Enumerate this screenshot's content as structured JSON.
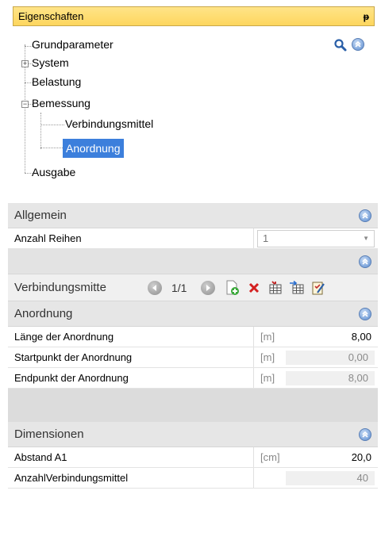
{
  "panel": {
    "title": "Eigenschaften",
    "pin_icon": "pin-icon"
  },
  "tree": {
    "items": [
      {
        "label": "Grundparameter"
      },
      {
        "label": "System"
      },
      {
        "label": "Belastung"
      },
      {
        "label": "Bemessung"
      },
      {
        "label": "Verbindungsmittel"
      },
      {
        "label": "Anordnung"
      },
      {
        "label": "Ausgabe"
      }
    ],
    "expanders": {
      "system": "+",
      "bemessung": "−"
    }
  },
  "grid": {
    "allgemein": {
      "title": "Allgemein",
      "anzahl_reihen_label": "Anzahl Reihen",
      "anzahl_reihen_value": "1"
    },
    "verbindungsmittel": {
      "label": "Verbindungsmitte",
      "page": "1/1"
    },
    "anordnung": {
      "title": "Anordnung",
      "rows": [
        {
          "label": "Länge der Anordnung",
          "unit": "[m]",
          "value": "8,00"
        },
        {
          "label": "Startpunkt der Anordnung",
          "unit": "[m]",
          "value": "0,00"
        },
        {
          "label": "Endpunkt der Anordnung",
          "unit": "[m]",
          "value": "8,00"
        }
      ]
    },
    "dimensionen": {
      "title": "Dimensionen",
      "rows": [
        {
          "label": "Abstand A1",
          "unit": "[cm]",
          "value": "20,0"
        },
        {
          "label": "AnzahlVerbindungsmittel",
          "unit": "",
          "value": "40"
        }
      ]
    }
  },
  "colors": {
    "title_bar": "#fdd65e",
    "selection": "#3c7fdc",
    "section_bg": "#e6e6e6"
  }
}
